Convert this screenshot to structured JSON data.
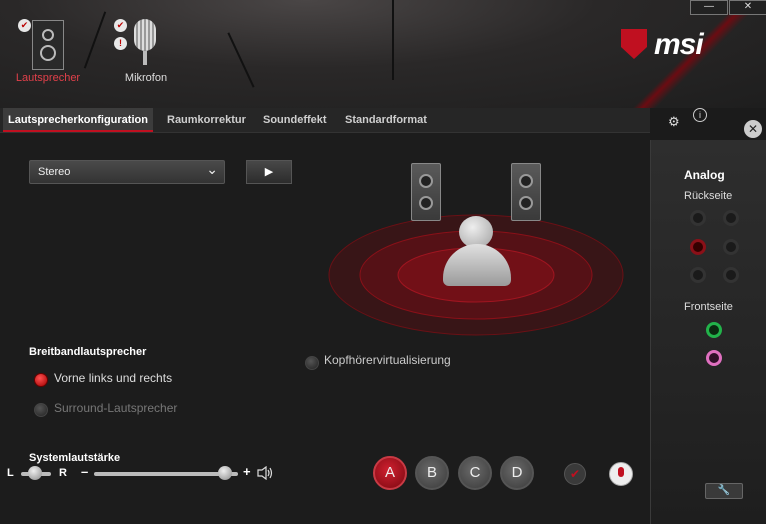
{
  "devices": [
    {
      "label": "Lautsprecher",
      "active": true
    },
    {
      "label": "Mikrofon",
      "active": false
    }
  ],
  "window_buttons": {
    "minimize": "—",
    "close": "✕"
  },
  "brand": {
    "logo_text": "msi",
    "accent": "#c01020"
  },
  "tabs": [
    {
      "label": "Lautsprecherkonfiguration",
      "active": true
    },
    {
      "label": "Raumkorrektur",
      "active": false
    },
    {
      "label": "Soundeffekt",
      "active": false
    },
    {
      "label": "Standardformat",
      "active": false
    }
  ],
  "config": {
    "mode_selected": "Stereo",
    "dropdown_arrow": "⌄",
    "play_icon": "▶"
  },
  "broadband": {
    "title": "Breitbandlautsprecher",
    "options": [
      {
        "label": "Vorne links und rechts",
        "checked": true,
        "enabled": true
      },
      {
        "label": "Surround-Lautsprecher",
        "checked": false,
        "enabled": false
      }
    ]
  },
  "headphone_virtualization": {
    "label": "Kopfhörervirtualisierung",
    "checked": false
  },
  "volume": {
    "title": "Systemlautstärke",
    "left_label": "L",
    "right_label": "R",
    "minus": "–",
    "plus": "+",
    "level": 0.95
  },
  "jacks": [
    "A",
    "B",
    "C",
    "D"
  ],
  "right_panel": {
    "analog_title": "Analog",
    "rear_title": "Rückseite",
    "front_title": "Frontseite"
  }
}
